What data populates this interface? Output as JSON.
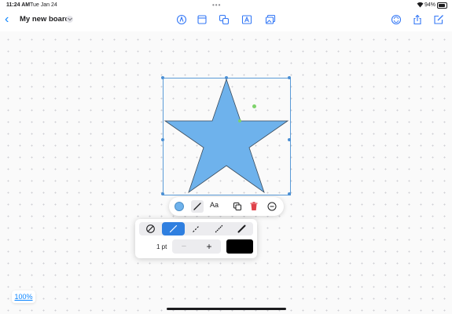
{
  "status": {
    "time": "11:24 AM",
    "date": "Tue Jan 24",
    "battery": "94%"
  },
  "header": {
    "title": "My new board"
  },
  "icons": {
    "back": "chevron-left-icon",
    "title_menu": "chevron-down-icon",
    "pen": "pen-tool-icon",
    "sticky_note": "sticky-note-icon",
    "shapes": "shapes-icon",
    "text_box": "text-box-icon",
    "media": "photo-icon",
    "collaborate": "collaborate-icon",
    "share": "share-icon",
    "new_board": "new-board-icon"
  },
  "selection": {
    "shape": "star",
    "fill_color": "#6eb2ec",
    "stroke_color": "#3a4a5a"
  },
  "shape_bar": {
    "text_label": "Aa"
  },
  "stroke_panel": {
    "styles": [
      "none",
      "solid",
      "dashed",
      "dotted",
      "brush"
    ],
    "selected_style": "solid",
    "width_label": "1 pt",
    "minus_label": "−",
    "plus_label": "+",
    "stroke_color": "#000000"
  },
  "zoom": {
    "label": "100%"
  },
  "colors": {
    "accent": "#0a84ff",
    "active_style": "#2f7fe0",
    "delete": "#e0424a"
  }
}
